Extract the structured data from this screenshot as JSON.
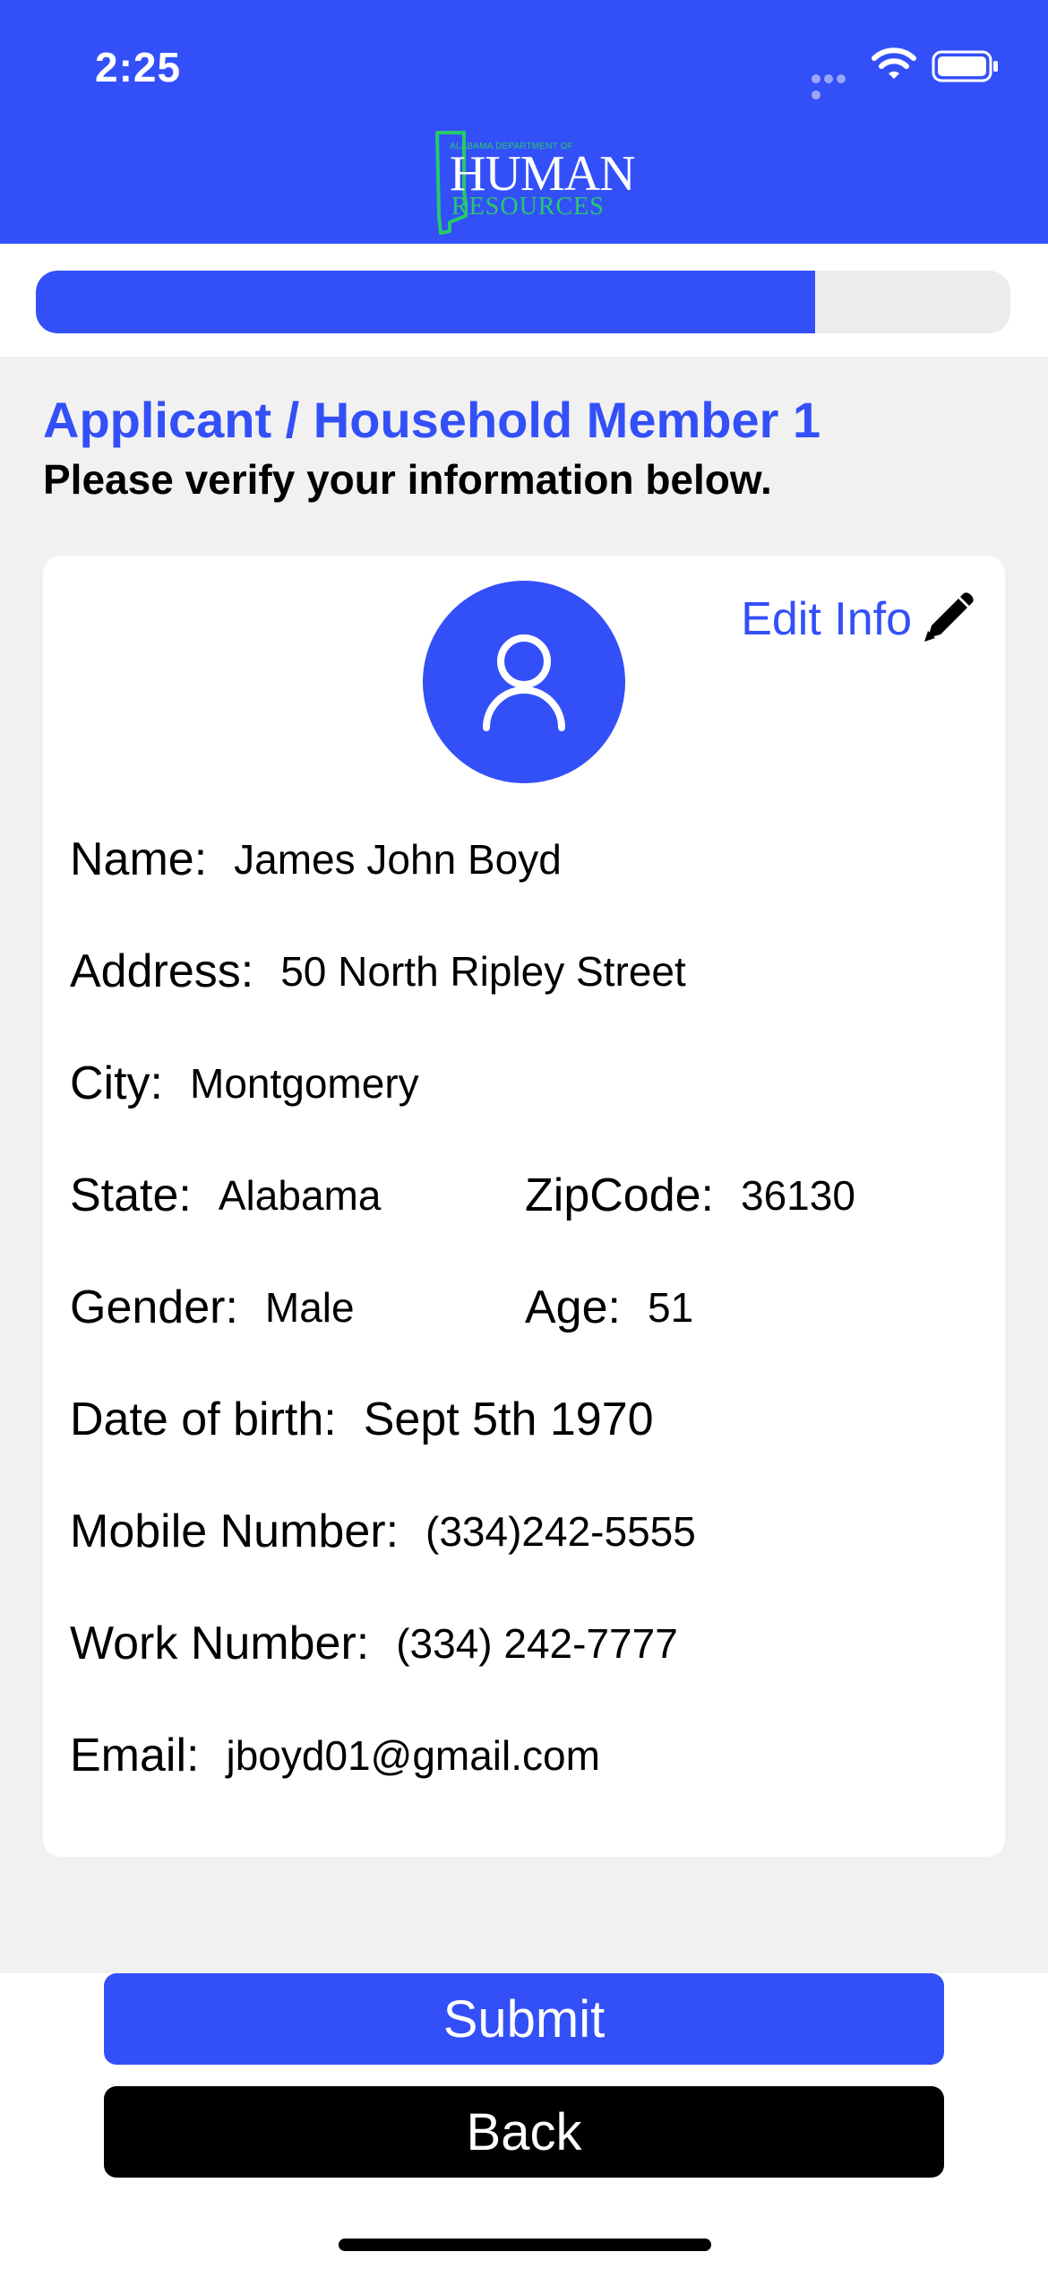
{
  "status_bar": {
    "time": "2:25",
    "icons": [
      "signal-dots-icon",
      "wifi-icon",
      "battery-icon"
    ]
  },
  "header": {
    "logo": {
      "line1": "ALABAMA DEPARTMENT OF",
      "line2": "HUMAN",
      "line3": "RESOURCES"
    },
    "background_color": "#3350f8"
  },
  "progress": {
    "fraction": 0.8
  },
  "page": {
    "title": "Applicant / Household Member 1",
    "subtitle": "Please verify your information below."
  },
  "card": {
    "edit_label": "Edit Info",
    "edit_icon": "pencil-icon",
    "avatar_icon": "person-icon",
    "fields": {
      "name": {
        "label": "Name:",
        "value": "James John Boyd"
      },
      "address": {
        "label": "Address:",
        "value": "50 North Ripley Street"
      },
      "city": {
        "label": "City:",
        "value": "Montgomery"
      },
      "state": {
        "label": "State:",
        "value": "Alabama"
      },
      "zipcode": {
        "label": "ZipCode:",
        "value": "36130"
      },
      "gender": {
        "label": "Gender:",
        "value": "Male"
      },
      "age": {
        "label": "Age:",
        "value": "51"
      },
      "dob": {
        "label": "Date of birth:",
        "value": "Sept 5th 1970"
      },
      "mobile": {
        "label": "Mobile Number:",
        "value": "(334)242-5555"
      },
      "work": {
        "label": "Work Number:",
        "value": "(334) 242-7777"
      },
      "email": {
        "label": "Email:",
        "value": "jboyd01@gmail.com"
      }
    }
  },
  "buttons": {
    "submit": "Submit",
    "back": "Back"
  },
  "colors": {
    "accent": "#3350f8",
    "logo_green": "#27c96a",
    "content_bg": "#f1f1f1"
  }
}
